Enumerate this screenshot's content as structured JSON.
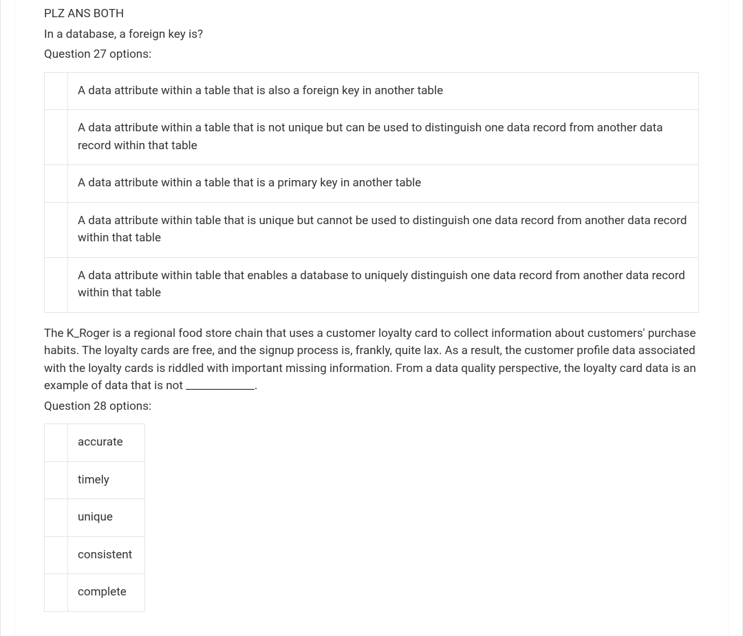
{
  "header": "PLZ ANS BOTH",
  "q27": {
    "stem": "In a database, a foreign key is?",
    "label": "Question 27 options:",
    "options": [
      "A data attribute within a table that is also a foreign key in another table",
      "A data attribute within a table that is not unique but can be used to distinguish one data record from another data record within that table",
      "A data attribute within a table that is a primary key in another table",
      "A data attribute within table that is unique but cannot be used to distinguish one data record from another data record within that table",
      "A data attribute within table that enables a database to uniquely distinguish one data record from another data record within that table"
    ]
  },
  "q28": {
    "stem": "The K_Roger is a regional food store chain that uses a customer loyalty card to collect information about customers' purchase habits. The loyalty cards are free, and the signup process is, frankly, quite lax. As a result, the customer profile data associated with the loyalty cards is riddled with important missing information. From a data quality perspective, the loyalty card data is an example of data that is not _____________.",
    "label": "Question 28 options:",
    "options": [
      "accurate",
      "timely",
      "unique",
      "consistent",
      "complete"
    ]
  }
}
